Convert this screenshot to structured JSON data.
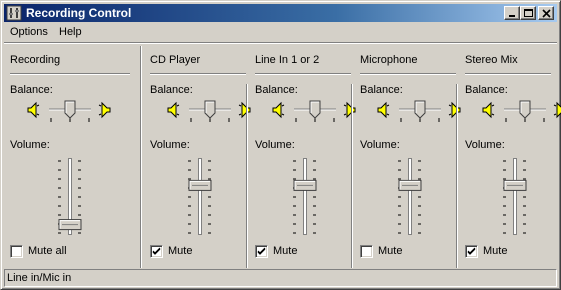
{
  "window": {
    "title": "Recording Control",
    "icon": "mixer-icon"
  },
  "menu": [
    "Options",
    "Help"
  ],
  "labels": {
    "balance": "Balance:",
    "volume": "Volume:"
  },
  "channels": [
    {
      "name": "Recording",
      "mute_label": "Mute all",
      "muted": false,
      "balance": 0.5,
      "volume": 0.12
    },
    {
      "name": "CD Player",
      "mute_label": "Mute",
      "muted": true,
      "balance": 0.5,
      "volume": 0.68
    },
    {
      "name": "Line In 1 or 2",
      "mute_label": "Mute",
      "muted": true,
      "balance": 0.5,
      "volume": 0.68
    },
    {
      "name": "Microphone",
      "mute_label": "Mute",
      "muted": false,
      "balance": 0.5,
      "volume": 0.68
    },
    {
      "name": "Stereo Mix",
      "mute_label": "Mute",
      "muted": true,
      "balance": 0.5,
      "volume": 0.68
    }
  ],
  "status": "Line in/Mic in"
}
